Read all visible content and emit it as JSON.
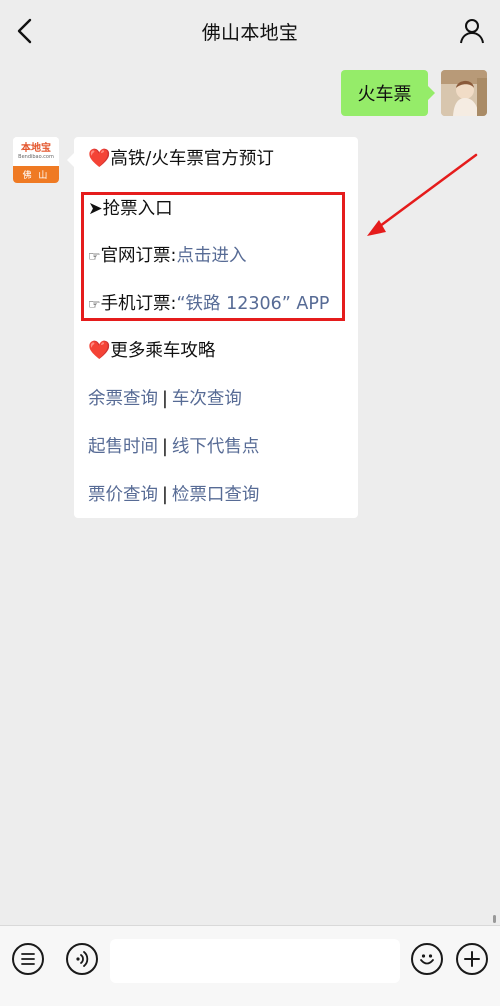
{
  "header": {
    "title": "佛山本地宝",
    "back_icon": "chevron-left-icon",
    "profile_icon": "person-icon"
  },
  "outgoing": {
    "text": "火车票",
    "bubble_color": "#95ec69"
  },
  "incoming": {
    "avatar": {
      "brand": "本地宝",
      "domain": "Bendibao.com",
      "city": "佛 山"
    },
    "heading": {
      "emoji": "❤️",
      "text": "高铁/火车票官方预订"
    },
    "grab": {
      "title": "➤抢票入口",
      "official_prefix": "官网订票:",
      "official_link": "点击进入",
      "mobile_prefix": "手机订票:",
      "mobile_link": "“铁路 12306” APP"
    },
    "more": {
      "emoji": "❤️",
      "text": "更多乘车攻略"
    },
    "links": [
      {
        "a": "余票查询",
        "sep": "|",
        "b": "车次查询"
      },
      {
        "a": "起售时间",
        "sep": "|",
        "b": "线下代售点"
      },
      {
        "a": "票价查询",
        "sep": "|",
        "b": "检票口查询"
      }
    ],
    "link_color": "#576b95",
    "highlight_color": "#e51c1c"
  },
  "input_bar": {
    "list_icon": "list-icon",
    "voice_icon": "voice-icon",
    "emoji_icon": "smile-icon",
    "plus_icon": "plus-icon",
    "placeholder": ""
  }
}
